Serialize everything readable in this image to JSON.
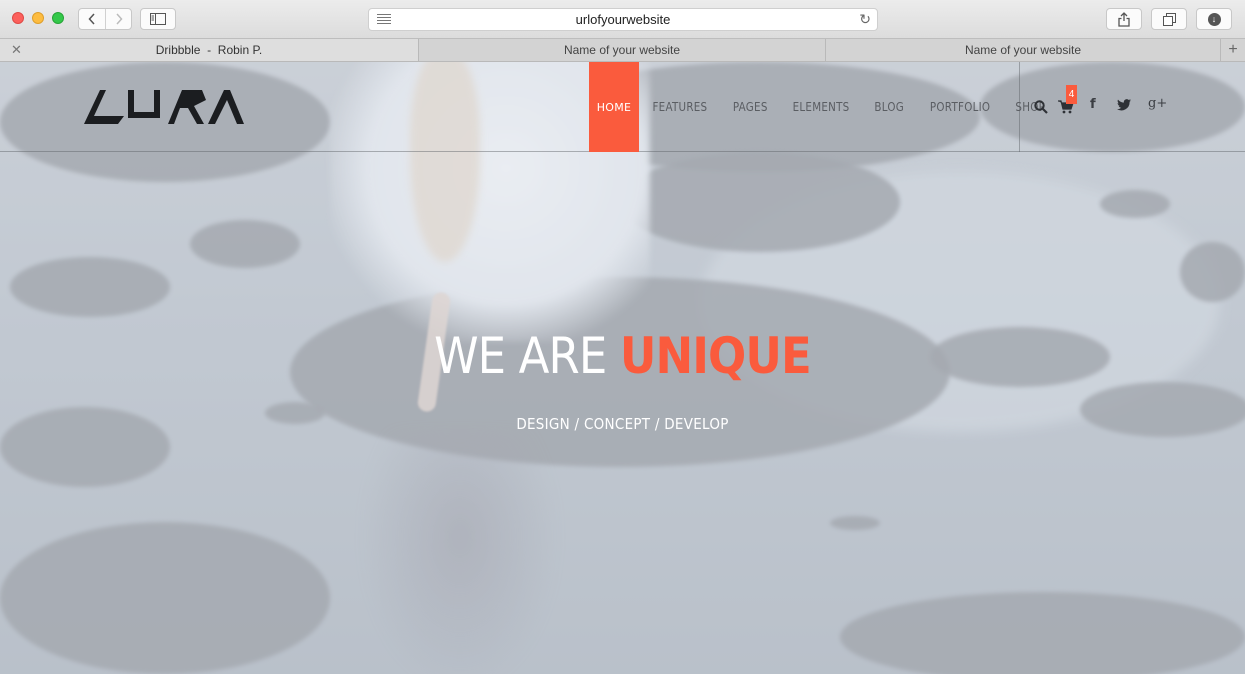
{
  "browser": {
    "url": "urlofyourwebsite",
    "tabs": [
      {
        "title": "Dribbble  -  Robin P.",
        "active": true
      },
      {
        "title": "Name of your website",
        "active": false
      },
      {
        "title": "Name of your website",
        "active": false
      }
    ]
  },
  "site": {
    "logo_text": "AURA",
    "nav": [
      "HOME",
      "FEATURES",
      "PAGES",
      "ELEMENTS",
      "BLOG",
      "PORTFOLIO",
      "SHOP"
    ],
    "active_nav": "HOME",
    "cart_count": "4",
    "accent_color": "#fa5b3d",
    "social_icons": [
      "facebook-icon",
      "twitter-icon",
      "google-plus-icon"
    ]
  },
  "hero": {
    "title_plain": "WE ARE ",
    "title_accent": "UNIQUE",
    "subtitle": "DESIGN / CONCEPT / DEVELOP"
  }
}
